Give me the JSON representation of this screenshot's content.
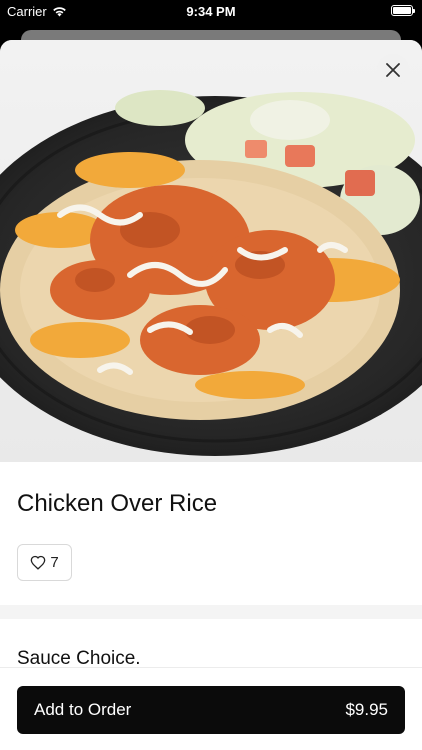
{
  "status": {
    "carrier": "Carrier",
    "time": "9:34 PM"
  },
  "item": {
    "name": "Chicken Over Rice",
    "likes": "7",
    "image_alt": "Chicken over rice with lettuce, tomato, cheese and white sauce on a dark plate"
  },
  "sections": {
    "sauce_title": "Sauce Choice."
  },
  "cta": {
    "label": "Add to Order",
    "price": "$9.95"
  },
  "colors": {
    "button_bg": "#0b0b0b",
    "sheet_bg": "#ffffff",
    "band_bg": "#f4f4f4"
  },
  "icons": {
    "close": "close-icon",
    "heart": "heart-icon",
    "wifi": "wifi-icon",
    "battery": "battery-icon"
  }
}
